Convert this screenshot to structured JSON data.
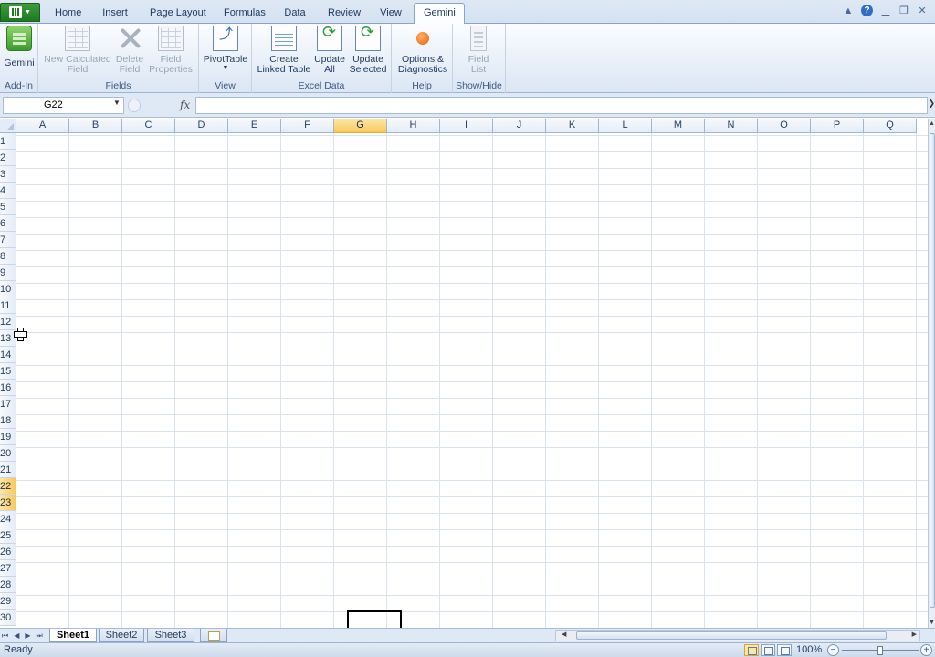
{
  "ribbon": {
    "file_icon": "excel-file-icon",
    "tabs": [
      {
        "label": "Home"
      },
      {
        "label": "Insert"
      },
      {
        "label": "Page Layout"
      },
      {
        "label": "Formulas"
      },
      {
        "label": "Data"
      },
      {
        "label": "Review"
      },
      {
        "label": "View"
      },
      {
        "label": "Gemini",
        "active": true
      }
    ],
    "groups": [
      {
        "label": "Add-In",
        "buttons": [
          {
            "label": "Gemini",
            "icon": "gemini-icon"
          }
        ]
      },
      {
        "label": "Fields",
        "buttons": [
          {
            "label": "New Calculated Field",
            "line1": "New Calculated",
            "line2": "Field",
            "icon": "calculated-field-icon",
            "disabled": true
          },
          {
            "label": "Delete Field",
            "line1": "Delete",
            "line2": "Field",
            "icon": "delete-icon",
            "disabled": true
          },
          {
            "label": "Field Properties",
            "line1": "Field",
            "line2": "Properties",
            "icon": "field-properties-icon",
            "disabled": true
          }
        ]
      },
      {
        "label": "View",
        "buttons": [
          {
            "label": "PivotTable",
            "icon": "pivottable-icon",
            "dropdown": true
          }
        ]
      },
      {
        "label": "Excel Data",
        "buttons": [
          {
            "label": "Create Linked Table",
            "line1": "Create",
            "line2": "Linked Table",
            "icon": "linked-table-icon"
          },
          {
            "label": "Update All",
            "line1": "Update",
            "line2": "All",
            "icon": "update-all-icon"
          },
          {
            "label": "Update Selected",
            "line1": "Update",
            "line2": "Selected",
            "icon": "update-selected-icon"
          }
        ]
      },
      {
        "label": "Help",
        "buttons": [
          {
            "label": "Options & Diagnostics",
            "line1": "Options &",
            "line2": "Diagnostics",
            "icon": "options-icon"
          }
        ]
      },
      {
        "label": "Show/Hide",
        "buttons": [
          {
            "label": "Field List",
            "line1": "Field",
            "line2": "List",
            "icon": "field-list-icon",
            "disabled": true
          }
        ]
      }
    ],
    "window_controls": [
      "minimize-icon",
      "help-icon",
      "restore-icon",
      "close-icon"
    ]
  },
  "formula_bar": {
    "name_box": "G22",
    "fx_label": "fx",
    "formula": ""
  },
  "grid": {
    "columns": [
      "A",
      "B",
      "C",
      "D",
      "E",
      "F",
      "G",
      "H",
      "I",
      "J",
      "K",
      "L",
      "M",
      "N",
      "O",
      "P",
      "Q"
    ],
    "rows": [
      "1",
      "2",
      "3",
      "4",
      "5",
      "6",
      "7",
      "8",
      "9",
      "10",
      "11",
      "12",
      "13",
      "14",
      "15",
      "16",
      "17",
      "18",
      "19",
      "20",
      "21",
      "22",
      "23",
      "24",
      "25",
      "26",
      "27",
      "28",
      "29",
      "30"
    ],
    "selected_column": "G",
    "selected_rows": [
      "22",
      "23"
    ]
  },
  "sheets": {
    "tabs": [
      {
        "label": "Sheet1",
        "active": true
      },
      {
        "label": "Sheet2"
      },
      {
        "label": "Sheet3"
      }
    ]
  },
  "status": {
    "text": "Ready",
    "zoom": "100%",
    "zoom_minus": "−",
    "zoom_plus": "+"
  }
}
